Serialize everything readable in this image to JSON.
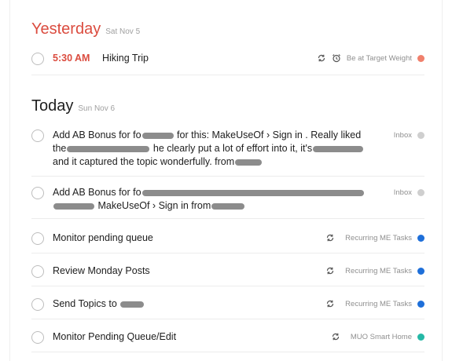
{
  "sections": [
    {
      "title": "Yesterday",
      "date": "Sat Nov 5",
      "tasks": [
        {
          "time": "5:30 AM",
          "title": "Hiking Trip",
          "project": "Be at Target Weight",
          "project_color": "#f0806c"
        }
      ]
    },
    {
      "title": "Today",
      "date": "Sun Nov 6",
      "tasks": [
        {
          "line1_a": "Add AB Bonus for fo",
          "line1_b": " for this: MakeUseOf › Sign in . Really liked",
          "line2_a": "the",
          "line2_b": " he clearly put a lot of effort into it, it's",
          "line3": "and it captured the topic wonderfully. from",
          "project": "Inbox",
          "project_color": "#cfcfcf"
        },
        {
          "line1_a": "Add AB Bonus for fo",
          "line2_b": " MakeUseOf › Sign in from",
          "project": "Inbox",
          "project_color": "#cfcfcf"
        },
        {
          "title": "Monitor pending queue",
          "project": "Recurring ME Tasks",
          "project_color": "#1e6fd9"
        },
        {
          "title": "Review Monday Posts",
          "project": "Recurring ME Tasks",
          "project_color": "#1e6fd9"
        },
        {
          "title": "Send Topics to",
          "project": "Recurring ME Tasks",
          "project_color": "#1e6fd9"
        },
        {
          "title": "Monitor Pending Queue/Edit",
          "project": "MUO Smart Home",
          "project_color": "#25b8a6"
        }
      ]
    }
  ],
  "icons": {
    "recurring": "recurring-icon",
    "alarm": "alarm-clock-icon"
  }
}
